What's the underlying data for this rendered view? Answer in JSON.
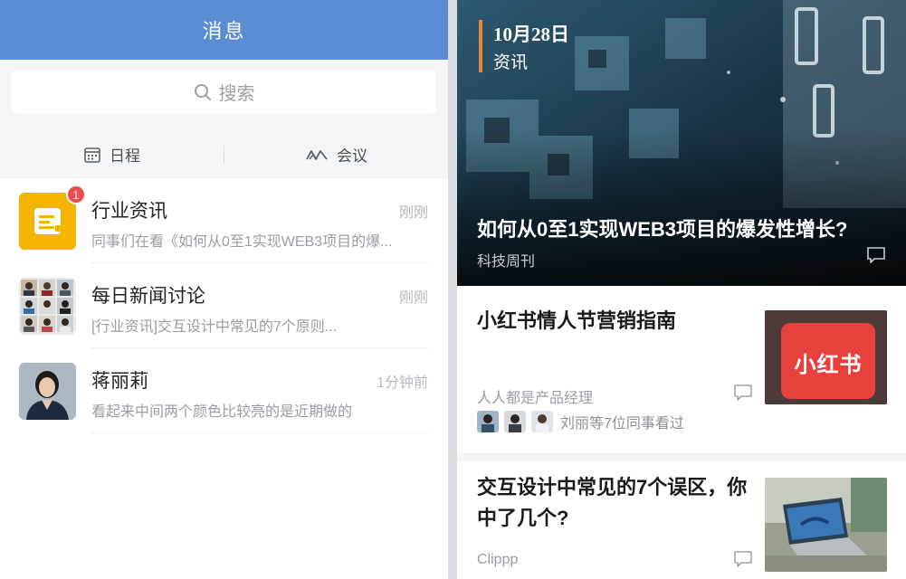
{
  "messages": {
    "header_title": "消息",
    "search_placeholder": "搜索",
    "tabs": [
      {
        "label": "日程",
        "icon": "calendar-icon"
      },
      {
        "label": "会议",
        "icon": "meeting-icon"
      }
    ],
    "conversations": [
      {
        "name": "行业资讯",
        "time": "刚刚",
        "preview": "同事们在看《如何从0至1实现WEB3项目的爆...",
        "badge": "1",
        "avatar": "document-app-icon",
        "avatar_color": "#f5b400"
      },
      {
        "name": "每日新闻讨论",
        "time": "刚刚",
        "preview": "[行业资讯]交互设计中常见的7个原则...",
        "avatar": "group-avatar-grid"
      },
      {
        "name": "蒋丽莉",
        "time": "1分钟前",
        "preview": "看起来中间两个颜色比较亮的是近期做的",
        "avatar": "person-avatar"
      }
    ]
  },
  "feed": {
    "hero": {
      "date": "10月28日",
      "category": "资讯",
      "headline": "如何从0至1实现WEB3项目的爆发性增长?",
      "source": "科技周刊",
      "accent": "#e8873a"
    },
    "articles": [
      {
        "title": "小红书情人节营销指南",
        "source": "人人都是产品经理",
        "readers_text": "刘丽等7位同事看过",
        "thumb_text": "小红书",
        "thumb_color": "#e8403c"
      },
      {
        "title_line1": "交互设计中常见的7个误区，你",
        "title_line2": "中了几个?",
        "source": "Clippp"
      }
    ]
  },
  "colors": {
    "header_blue": "#5b8dd4",
    "badge_red": "#f04a4a",
    "brand_red": "#e8403c"
  }
}
